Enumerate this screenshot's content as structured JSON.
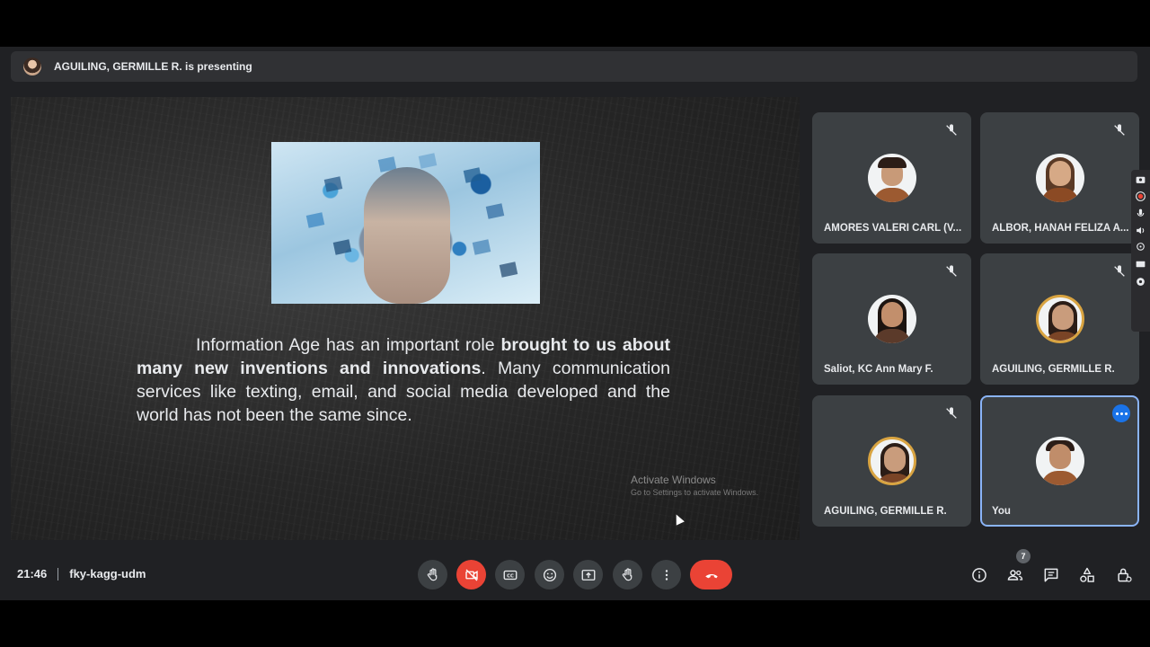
{
  "presenting_bar": {
    "text": "AGUILING, GERMILLE R. is presenting"
  },
  "slide": {
    "text_intro": "Information Age has an important role ",
    "text_bold_1": "brought to us about many new inventions and innovations",
    "text_rest": ". Many communication services like texting, email, and social media developed and the world has not been the same since."
  },
  "watermark": {
    "title": "Activate Windows",
    "subtitle": "Go to Settings to activate Windows."
  },
  "participants": [
    {
      "name": "AMORES VALERI CARL (V...",
      "muted": true
    },
    {
      "name": "ALBOR, HANAH FELIZA A...",
      "muted": true
    },
    {
      "name": "Saliot, KC Ann Mary F.",
      "muted": true
    },
    {
      "name": "AGUILING, GERMILLE R.",
      "muted": true
    },
    {
      "name": "AGUILING, GERMILLE R.",
      "muted": true
    },
    {
      "name": "You",
      "muted": false
    }
  ],
  "meeting": {
    "time": "21:46",
    "code": "fky-kagg-udm"
  },
  "participants_count": "7",
  "colors": {
    "background": "#202124",
    "tile": "#3c4043",
    "hangup": "#ea4335",
    "accent": "#8ab4f8"
  },
  "controls": {
    "center": [
      "raise-hand-icon",
      "camera-off-icon",
      "captions-icon",
      "emoji-icon",
      "present-icon",
      "hand-icon",
      "more-options-icon",
      "hang-up-icon"
    ],
    "right": [
      "info-icon",
      "people-icon",
      "chat-icon",
      "activities-icon",
      "host-controls-icon"
    ]
  }
}
